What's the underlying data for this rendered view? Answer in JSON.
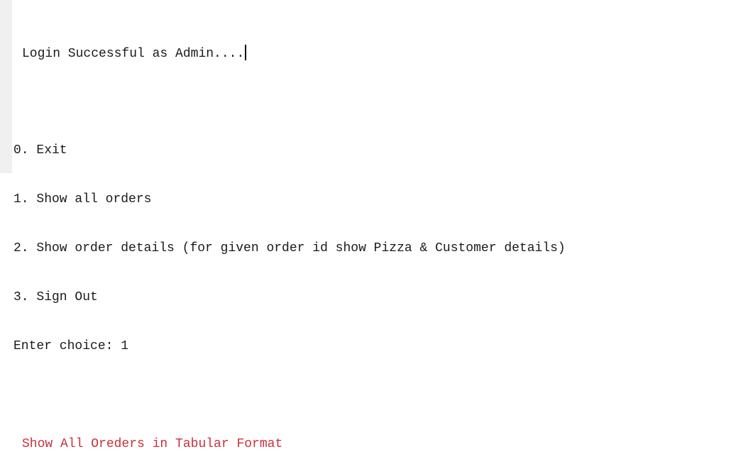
{
  "console": {
    "login_message": "Login Successful as Admin....",
    "menu": [
      "0. Exit",
      "1. Show all orders",
      "2. Show order details (for given order id show Pizza & Customer details)",
      "3. Sign Out"
    ],
    "prompt": "Enter choice: ",
    "input_value": "1",
    "section_heading": "Show All Oreders in Tabular Format"
  },
  "colors": {
    "text": "#1a1a1a",
    "heading": "#c8303a",
    "gutter": "#f0f0f0",
    "background": "#ffffff"
  }
}
